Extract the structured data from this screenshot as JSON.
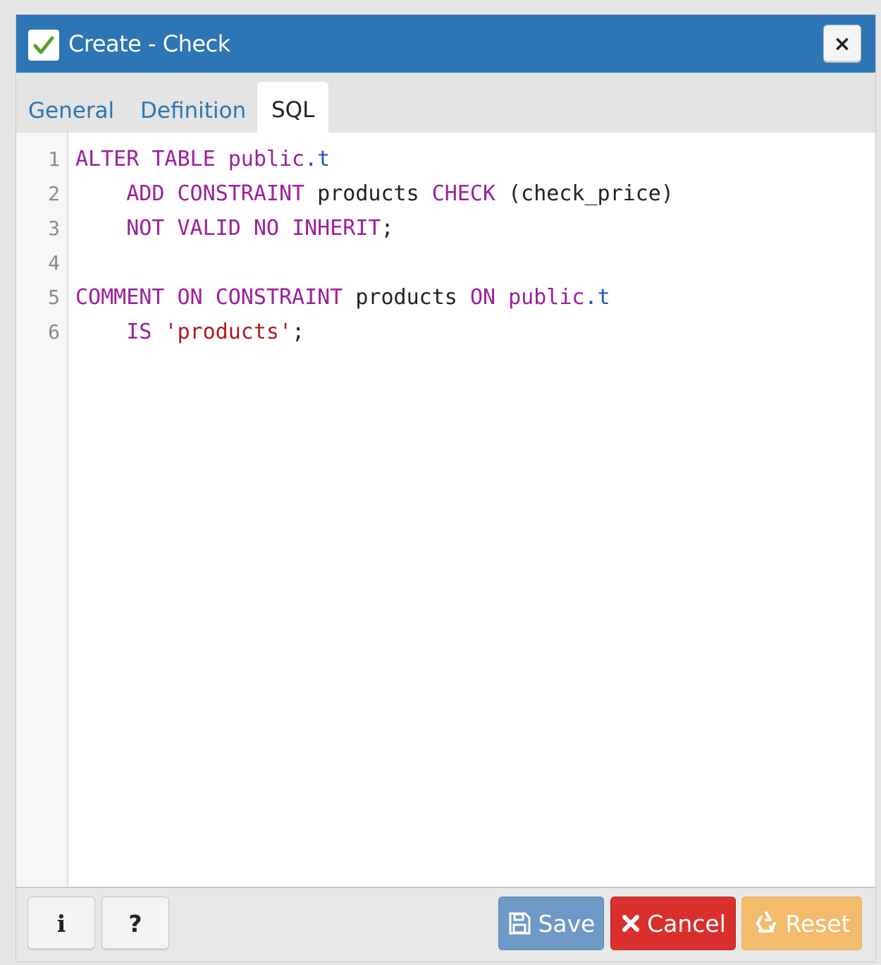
{
  "dialog": {
    "title": "Create - Check",
    "close_label": "×"
  },
  "tabs": [
    {
      "label": "General",
      "active": false
    },
    {
      "label": "Definition",
      "active": false
    },
    {
      "label": "SQL",
      "active": true
    }
  ],
  "editor": {
    "line_numbers": [
      "1",
      "2",
      "3",
      "4",
      "5",
      "6"
    ],
    "lines": [
      "ALTER TABLE public.t",
      "    ADD CONSTRAINT products CHECK (check_price)",
      "    NOT VALID NO INHERIT;",
      "",
      "COMMENT ON CONSTRAINT products ON public.t",
      "    IS 'products';"
    ]
  },
  "footer": {
    "info_label": "i",
    "help_label": "?",
    "save_label": "Save",
    "cancel_label": "Cancel",
    "reset_label": "Reset"
  },
  "colors": {
    "titlebar": "#2c76b5",
    "keyword": "#9c1f9c",
    "string": "#b0191f",
    "save": "#6f99c6",
    "cancel": "#d9302e",
    "reset": "#f2bc6c"
  }
}
